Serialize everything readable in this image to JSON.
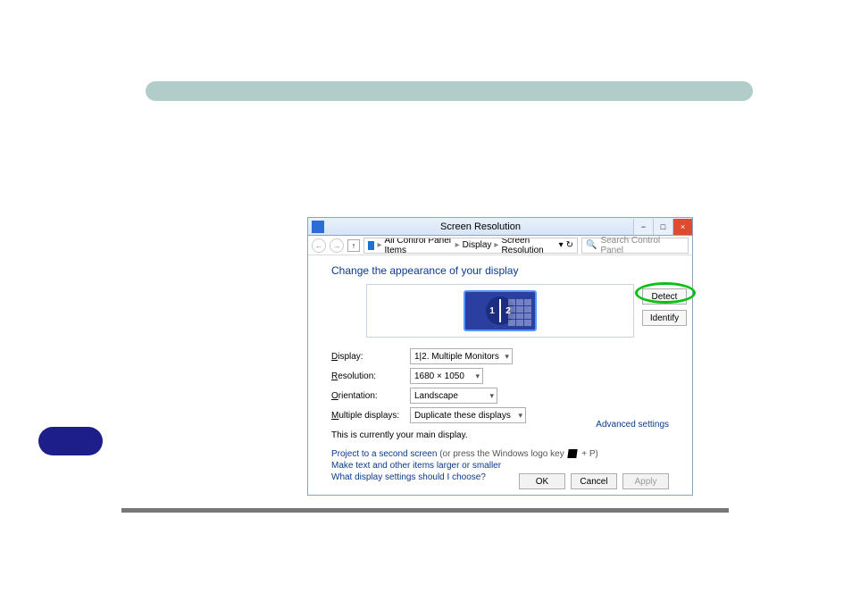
{
  "window": {
    "title": "Screen Resolution",
    "breadcrumb": [
      "All Control Panel Items",
      "Display",
      "Screen Resolution"
    ],
    "search_placeholder": "Search Control Panel",
    "window_buttons": {
      "min": "−",
      "max": "□",
      "close": "×"
    },
    "nav": {
      "back": "←",
      "forward": "→",
      "up": "↑",
      "refresh": "↻",
      "dropdown": "▾"
    }
  },
  "page": {
    "heading": "Change the appearance of your display",
    "detect_label": "Detect",
    "identify_label": "Identify",
    "fields": {
      "display_label": "Display:",
      "display_value": "1|2. Multiple Monitors",
      "resolution_label": "Resolution:",
      "resolution_value": "1680 × 1050",
      "orientation_label": "Orientation:",
      "orientation_value": "Landscape",
      "multipledisplays_label": "Multiple displays:",
      "multipledisplays_value": "Duplicate these displays"
    },
    "main_note": "This is currently your main display.",
    "advanced": "Advanced settings",
    "project_link": "Project to a second screen",
    "project_suffix": " (or press the Windows logo key ",
    "project_key": " + P)",
    "text_larger": "Make text and other items larger or smaller",
    "which_settings": "What display settings should I choose?",
    "buttons": {
      "ok": "OK",
      "cancel": "Cancel",
      "apply": "Apply"
    }
  }
}
